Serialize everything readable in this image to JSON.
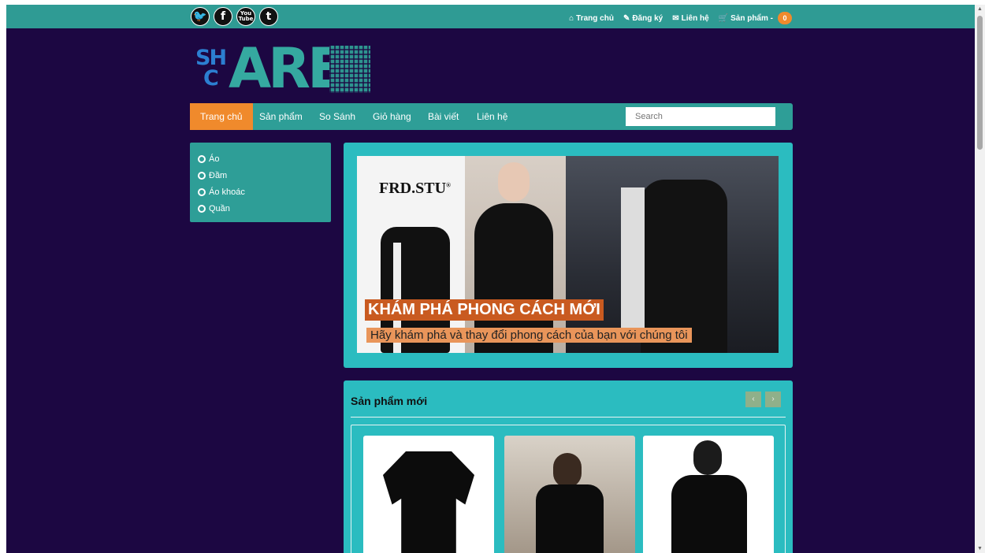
{
  "topbar": {
    "social": [
      {
        "icon": "twitter-icon",
        "glyph": "🐦"
      },
      {
        "icon": "facebook-icon",
        "glyph": "f"
      },
      {
        "icon": "youtube-icon",
        "glyph": "You Tube"
      },
      {
        "icon": "tumblr-icon",
        "glyph": "t"
      }
    ],
    "links": [
      {
        "icon": "home-icon",
        "glyph": "⌂",
        "label": "Trang chủ"
      },
      {
        "icon": "edit-icon",
        "glyph": "✎",
        "label": "Đăng ký"
      },
      {
        "icon": "envelope-icon",
        "glyph": "✉",
        "label": "Liên hệ"
      },
      {
        "icon": "cart-icon",
        "glyph": "🛒",
        "label": "Sản phẩm -"
      }
    ],
    "cart_count": "0"
  },
  "logo": {
    "small_top": "SH",
    "small_bottom": "C",
    "big": "ARE"
  },
  "nav": {
    "items": [
      "Trang chủ",
      "Sản phẩm",
      "So Sánh",
      "Giỏ hàng",
      "Bài viết",
      "Liên hệ"
    ],
    "search_placeholder": "Search"
  },
  "sidebar": {
    "categories": [
      "Áo",
      "Đầm",
      "Áo khoác",
      "Quần"
    ]
  },
  "banner": {
    "brand": "FRD.STU",
    "brand_mark": "®",
    "title": "KHÁM PHÁ PHONG CÁCH MỚI",
    "subtitle": "Hãy khám phá và thay đổi phong cách của bạn với chúng tôi"
  },
  "new_products": {
    "title": "Sản phẩm mới",
    "prev": "‹",
    "next": "›"
  },
  "colors": {
    "background": "#1c0742",
    "teal": "#2e9e97",
    "accent": "#f08a2c",
    "panel": "#2bbcc0"
  }
}
